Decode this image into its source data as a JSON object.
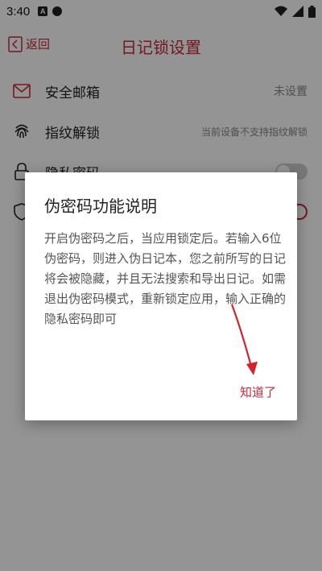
{
  "status_bar": {
    "time": "3:40",
    "icon_a": "A"
  },
  "header": {
    "back_label": "返回",
    "title": "日记锁设置"
  },
  "settings": {
    "items": [
      {
        "label": "安全邮箱",
        "value": "未设置"
      },
      {
        "label": "指纹解锁",
        "value": "当前设备不支持指纹解锁"
      },
      {
        "label": "隐私密码"
      },
      {
        "label": ""
      }
    ]
  },
  "dialog": {
    "title": "伪密码功能说明",
    "body": "开启伪密码之后，当应用锁定后。若输入6位伪密码，则进入伪日记本，您之前所写的日记将会被隐藏，并且无法搜索和导出日记。如需退出伪密码模式，重新锁定应用，输入正确的隐私密码即可",
    "confirm_label": "知道了"
  },
  "colors": {
    "accent": "#c6283a",
    "scrim": "rgba(0,0,0,0.42)"
  },
  "icons": [
    "envelope-icon",
    "fingerprint-icon",
    "lock-icon",
    "shield-icon",
    "back-icon",
    "wifi-icon",
    "signal-icon",
    "battery-icon"
  ]
}
